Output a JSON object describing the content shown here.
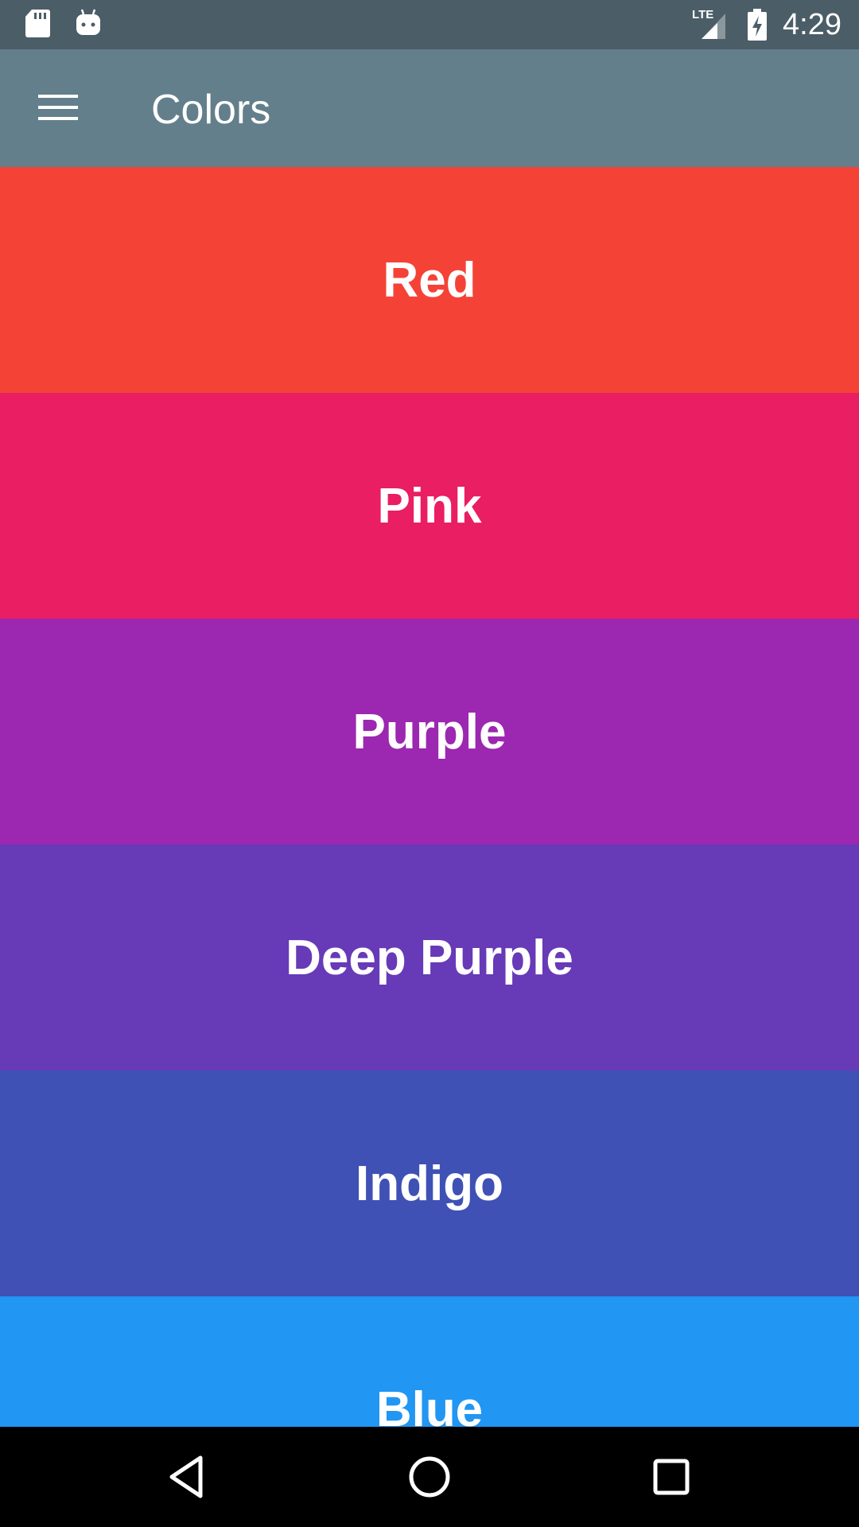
{
  "status_bar": {
    "time": "4:29",
    "network_label": "LTE",
    "left_icons": [
      "sd-card-icon",
      "android-debug-icon"
    ],
    "right_icons": [
      "lte-signal-icon",
      "battery-charging-icon"
    ],
    "background": "#4b5d67"
  },
  "app_bar": {
    "title": "Colors",
    "menu_icon": "hamburger-menu-icon",
    "background": "#637f8b"
  },
  "colors": [
    {
      "label": "Red",
      "hex": "#f44336"
    },
    {
      "label": "Pink",
      "hex": "#e91e63"
    },
    {
      "label": "Purple",
      "hex": "#9c27b0"
    },
    {
      "label": "Deep Purple",
      "hex": "#673ab7"
    },
    {
      "label": "Indigo",
      "hex": "#3f51b5"
    },
    {
      "label": "Blue",
      "hex": "#2196f3"
    }
  ],
  "nav_bar": {
    "buttons": [
      "back-icon",
      "home-icon",
      "recents-icon"
    ]
  }
}
